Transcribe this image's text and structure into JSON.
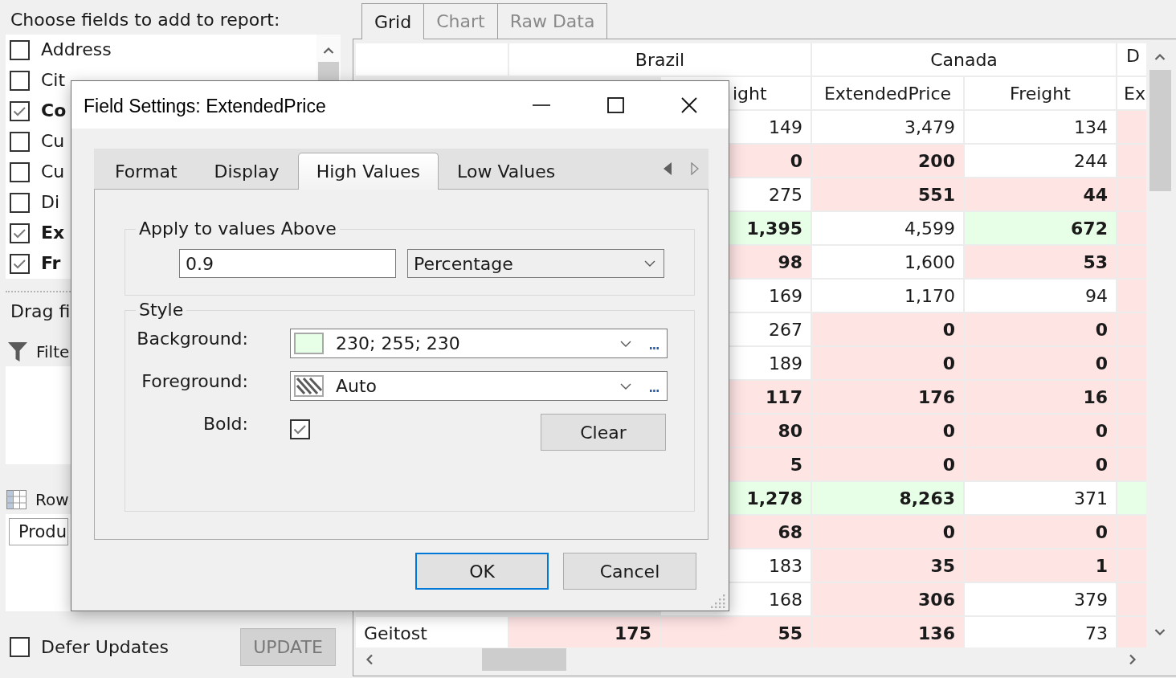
{
  "field_chooser": {
    "title": "Choose fields to add to report:",
    "fields": [
      {
        "label": "Address",
        "checked": false
      },
      {
        "label": "Cit",
        "checked": false
      },
      {
        "label": "Co",
        "checked": true
      },
      {
        "label": "Cu",
        "checked": false
      },
      {
        "label": "Cu",
        "checked": false
      },
      {
        "label": "Di",
        "checked": false
      },
      {
        "label": "Ex",
        "checked": true
      },
      {
        "label": "Fr",
        "checked": true
      }
    ]
  },
  "drag_hint": "Drag fi",
  "filter_area": {
    "label": "Filte"
  },
  "row_area": {
    "label": "Row",
    "items": [
      "Produ"
    ]
  },
  "defer_updates": {
    "label": "Defer Updates",
    "checked": false
  },
  "update_button": {
    "label": "UPDATE",
    "disabled": true
  },
  "view_tabs": [
    {
      "label": "Grid",
      "selected": true
    },
    {
      "label": "Chart",
      "selected": false
    },
    {
      "label": "Raw Data",
      "selected": false
    }
  ],
  "grid": {
    "groups": [
      "Brazil",
      "Canada",
      "D"
    ],
    "headers": [
      "ight",
      "ExtendedPrice",
      "Freight",
      "Ex"
    ],
    "rows": [
      {
        "cells": [
          {
            "value": "149",
            "kind": "plain"
          },
          {
            "value": "3,479",
            "kind": "plain"
          },
          {
            "value": "134",
            "kind": "plain"
          },
          {
            "kind": "low"
          }
        ]
      },
      {
        "cells": [
          {
            "value": "0",
            "kind": "low"
          },
          {
            "value": "200",
            "kind": "low"
          },
          {
            "value": "244",
            "kind": "plain"
          },
          {
            "kind": "low"
          }
        ]
      },
      {
        "cells": [
          {
            "value": "275",
            "kind": "plain"
          },
          {
            "value": "551",
            "kind": "low"
          },
          {
            "value": "44",
            "kind": "low"
          },
          {
            "kind": "low"
          }
        ]
      },
      {
        "cells": [
          {
            "value": "1,395",
            "kind": "high"
          },
          {
            "value": "4,599",
            "kind": "plain"
          },
          {
            "value": "672",
            "kind": "high"
          },
          {
            "kind": "low"
          }
        ]
      },
      {
        "cells": [
          {
            "value": "98",
            "kind": "low"
          },
          {
            "value": "1,600",
            "kind": "plain"
          },
          {
            "value": "53",
            "kind": "low"
          },
          {
            "kind": "low"
          }
        ]
      },
      {
        "cells": [
          {
            "value": "169",
            "kind": "plain"
          },
          {
            "value": "1,170",
            "kind": "plain"
          },
          {
            "value": "94",
            "kind": "plain"
          },
          {
            "kind": "low"
          }
        ]
      },
      {
        "cells": [
          {
            "value": "267",
            "kind": "plain"
          },
          {
            "value": "0",
            "kind": "low"
          },
          {
            "value": "0",
            "kind": "low"
          },
          {
            "kind": "low"
          }
        ]
      },
      {
        "cells": [
          {
            "value": "189",
            "kind": "plain"
          },
          {
            "value": "0",
            "kind": "low"
          },
          {
            "value": "0",
            "kind": "low"
          },
          {
            "kind": "low"
          }
        ]
      },
      {
        "cells": [
          {
            "value": "117",
            "kind": "low"
          },
          {
            "value": "176",
            "kind": "low"
          },
          {
            "value": "16",
            "kind": "low"
          },
          {
            "kind": "low"
          }
        ]
      },
      {
        "cells": [
          {
            "value": "80",
            "kind": "low"
          },
          {
            "value": "0",
            "kind": "low"
          },
          {
            "value": "0",
            "kind": "low"
          },
          {
            "kind": "low"
          }
        ]
      },
      {
        "cells": [
          {
            "value": "5",
            "kind": "low"
          },
          {
            "value": "0",
            "kind": "low"
          },
          {
            "value": "0",
            "kind": "low"
          },
          {
            "kind": "low"
          }
        ]
      },
      {
        "cells": [
          {
            "value": "1,278",
            "kind": "high"
          },
          {
            "value": "8,263",
            "kind": "high"
          },
          {
            "value": "371",
            "kind": "plain"
          },
          {
            "kind": "high"
          }
        ]
      },
      {
        "cells": [
          {
            "value": "68",
            "kind": "low"
          },
          {
            "value": "0",
            "kind": "low"
          },
          {
            "value": "0",
            "kind": "low"
          },
          {
            "kind": "low"
          }
        ]
      },
      {
        "cells": [
          {
            "value": "183",
            "kind": "plain"
          },
          {
            "value": "35",
            "kind": "low"
          },
          {
            "value": "1",
            "kind": "low"
          },
          {
            "kind": "low"
          }
        ]
      },
      {
        "cells": [
          {
            "value": "168",
            "kind": "plain"
          },
          {
            "value": "306",
            "kind": "low"
          },
          {
            "value": "379",
            "kind": "plain"
          },
          {
            "kind": "low"
          }
        ]
      },
      {
        "label": "Geitost",
        "column_2": {
          "value": "175",
          "kind": "low"
        },
        "cells": [
          {
            "value": "55",
            "kind": "low"
          },
          {
            "value": "136",
            "kind": "low"
          },
          {
            "value": "73",
            "kind": "plain"
          },
          {
            "kind": "low"
          }
        ]
      }
    ]
  },
  "dialog": {
    "title": "Field Settings: ExtendedPrice",
    "tabs": [
      {
        "label": "Format",
        "selected": false
      },
      {
        "label": "Display",
        "selected": false
      },
      {
        "label": "High Values",
        "selected": true
      },
      {
        "label": "Low Values",
        "selected": false
      }
    ],
    "tab_scroll": [
      {
        "kind": "left",
        "disabled": false
      },
      {
        "kind": "right",
        "disabled": true
      }
    ],
    "threshold": {
      "legend": "Apply to values Above",
      "value": "0.9",
      "mode": "Percentage"
    },
    "style": {
      "legend": "Style",
      "colors": [
        {
          "label": "Background:",
          "kind": "solid",
          "color": "#e6ffe6",
          "value": "230; 255; 230"
        },
        {
          "label": "Foreground:",
          "kind": "auto",
          "value": "Auto"
        }
      ],
      "bold": {
        "label": "Bold:",
        "checked": true
      },
      "clear_button": "Clear"
    },
    "buttons": [
      {
        "label": "OK",
        "default": true
      },
      {
        "label": "Cancel",
        "default": false
      }
    ]
  }
}
